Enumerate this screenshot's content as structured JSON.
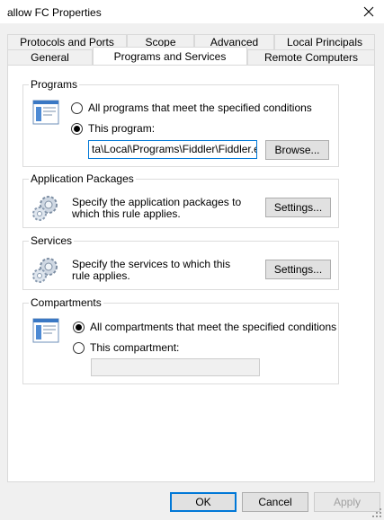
{
  "window": {
    "title": "allow FC Properties"
  },
  "tabs": {
    "row1": [
      "Protocols and Ports",
      "Scope",
      "Advanced",
      "Local Principals"
    ],
    "row2": [
      "General",
      "Programs and Services",
      "Remote Computers"
    ]
  },
  "programs": {
    "label": "Programs",
    "option_all": "All programs that meet the specified conditions",
    "option_this": "This program:",
    "path_value": "ta\\Local\\Programs\\Fiddler\\Fiddler.exe",
    "browse_label": "Browse..."
  },
  "app_packages": {
    "label": "Application Packages",
    "description": "Specify the application packages to which this rule applies.",
    "settings_label": "Settings..."
  },
  "services": {
    "label": "Services",
    "description": "Specify the services to which this rule applies.",
    "settings_label": "Settings..."
  },
  "compartments": {
    "label": "Compartments",
    "option_all": "All compartments that meet the specified conditions",
    "option_this": "This compartment:",
    "compartment_value": ""
  },
  "footer": {
    "ok": "OK",
    "cancel": "Cancel",
    "apply": "Apply"
  },
  "icons": {
    "close": "close-icon",
    "program": "program-window-icon",
    "gear": "gear-icon"
  },
  "colors": {
    "accent": "#0078d7",
    "panel": "#ffffff",
    "chrome": "#f0f0f0"
  }
}
